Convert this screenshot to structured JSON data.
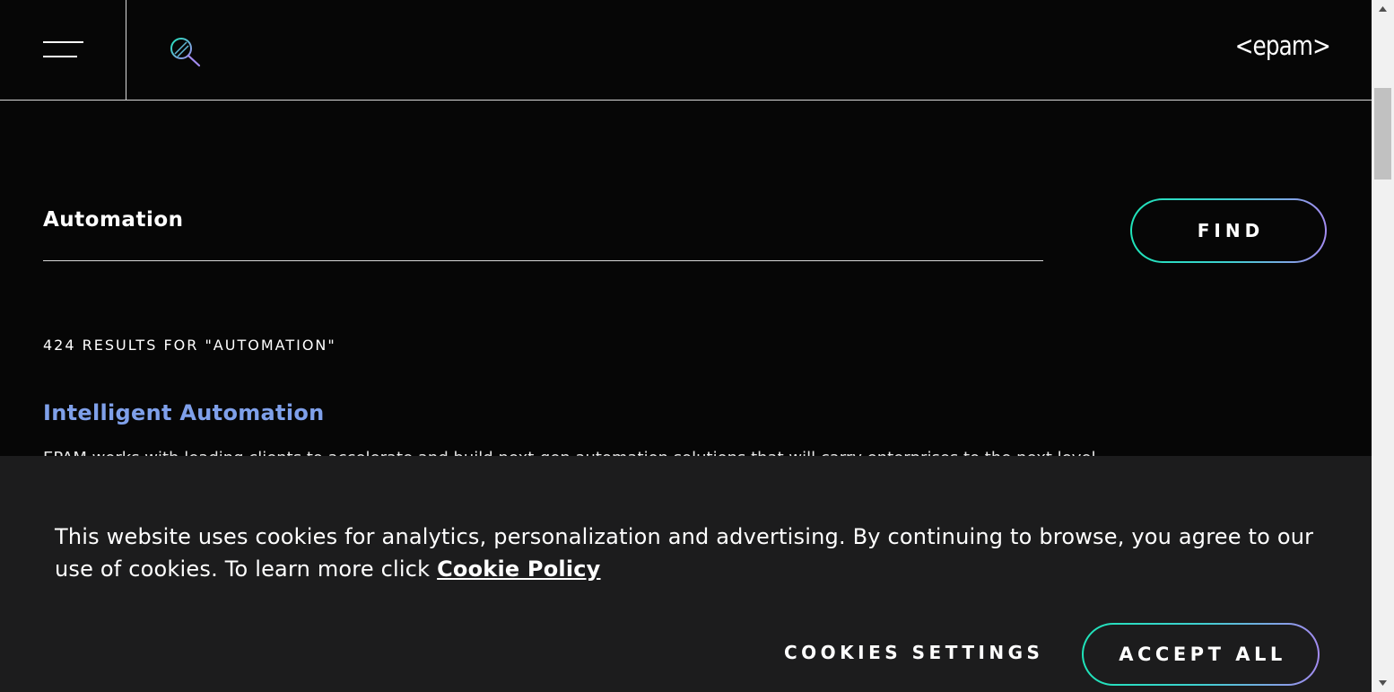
{
  "header": {
    "menu_icon": "hamburger-menu-icon",
    "search_icon": "search-icon",
    "logo_text": "<epam>"
  },
  "search": {
    "query": "Automation",
    "find_label": "FIND",
    "accent_gradient": [
      "#1fe3b9",
      "#a38bf0"
    ]
  },
  "results": {
    "count_label": "424 RESULTS FOR \"AUTOMATION\"",
    "items": [
      {
        "title": "Intelligent Automation",
        "title_color": "#7fa0ea",
        "snippet": "EPAM works with leading clients to accelerate and build next-gen automation solutions that will carry enterprises to the next level"
      }
    ]
  },
  "cookie_banner": {
    "text": "This website uses cookies for analytics, personalization and advertising. By continuing to browse, you agree to our use of cookies. To learn more click ",
    "policy_link": "Cookie Policy",
    "settings_label": "COOKIES SETTINGS",
    "accept_label": "ACCEPT ALL"
  },
  "colors": {
    "background": "#060606",
    "banner_background": "#1c1c1d"
  }
}
